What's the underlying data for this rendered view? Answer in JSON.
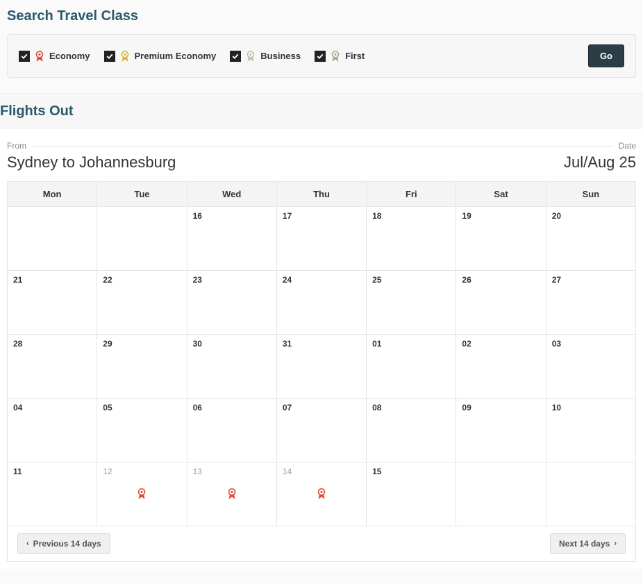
{
  "search": {
    "title": "Search Travel Class",
    "options": [
      {
        "label": "Economy",
        "color": "#e04a3a",
        "checked": true
      },
      {
        "label": "Premium Economy",
        "color": "#e0b33a",
        "checked": true
      },
      {
        "label": "Business",
        "color": "#c8c0a8",
        "checked": true
      },
      {
        "label": "First",
        "color": "#b0a890",
        "checked": true
      }
    ],
    "go_label": "Go"
  },
  "flights": {
    "title": "Flights Out",
    "from_label": "From",
    "date_label": "Date",
    "route": "Sydney to Johannesburg",
    "period": "Jul/Aug 25",
    "weekdays": [
      "Mon",
      "Tue",
      "Wed",
      "Thu",
      "Fri",
      "Sat",
      "Sun"
    ],
    "weeks": [
      [
        {
          "day": ""
        },
        {
          "day": ""
        },
        {
          "day": "16"
        },
        {
          "day": "17"
        },
        {
          "day": "18"
        },
        {
          "day": "19"
        },
        {
          "day": "20"
        }
      ],
      [
        {
          "day": "21"
        },
        {
          "day": "22"
        },
        {
          "day": "23"
        },
        {
          "day": "24"
        },
        {
          "day": "25"
        },
        {
          "day": "26"
        },
        {
          "day": "27"
        }
      ],
      [
        {
          "day": "28"
        },
        {
          "day": "29"
        },
        {
          "day": "30"
        },
        {
          "day": "31"
        },
        {
          "day": "01"
        },
        {
          "day": "02"
        },
        {
          "day": "03"
        }
      ],
      [
        {
          "day": "04"
        },
        {
          "day": "05"
        },
        {
          "day": "06"
        },
        {
          "day": "07"
        },
        {
          "day": "08"
        },
        {
          "day": "09"
        },
        {
          "day": "10"
        }
      ],
      [
        {
          "day": "11"
        },
        {
          "day": "12",
          "muted": true,
          "award": "#e04a3a"
        },
        {
          "day": "13",
          "muted": true,
          "award": "#e04a3a"
        },
        {
          "day": "14",
          "muted": true,
          "award": "#e04a3a"
        },
        {
          "day": "15"
        },
        {
          "day": ""
        },
        {
          "day": ""
        }
      ]
    ],
    "prev_label": "Previous 14 days",
    "next_label": "Next 14 days"
  }
}
